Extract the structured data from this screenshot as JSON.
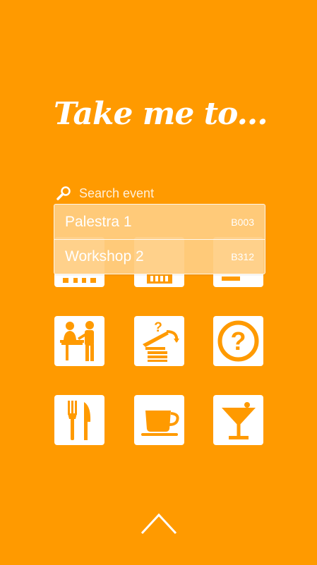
{
  "header": {
    "title": "Take me to..."
  },
  "search": {
    "placeholder": "Search event"
  },
  "suggestions": [
    {
      "name": "Palestra 1",
      "code": "B003"
    },
    {
      "name": "Workshop 2",
      "code": "B312"
    }
  ],
  "tiles": [
    {
      "icon": "seating-icon"
    },
    {
      "icon": "building-icon"
    },
    {
      "icon": "stairs-icon"
    },
    {
      "icon": "reception-desk-icon"
    },
    {
      "icon": "information-icon"
    },
    {
      "icon": "help-icon"
    },
    {
      "icon": "restaurant-icon"
    },
    {
      "icon": "coffee-icon"
    },
    {
      "icon": "bar-icon"
    }
  ],
  "footer": {
    "icon": "chevron-up-icon"
  },
  "colors": {
    "background": "#FF9A00",
    "tile": "#FFFFFF",
    "icon": "#FF9A00"
  }
}
